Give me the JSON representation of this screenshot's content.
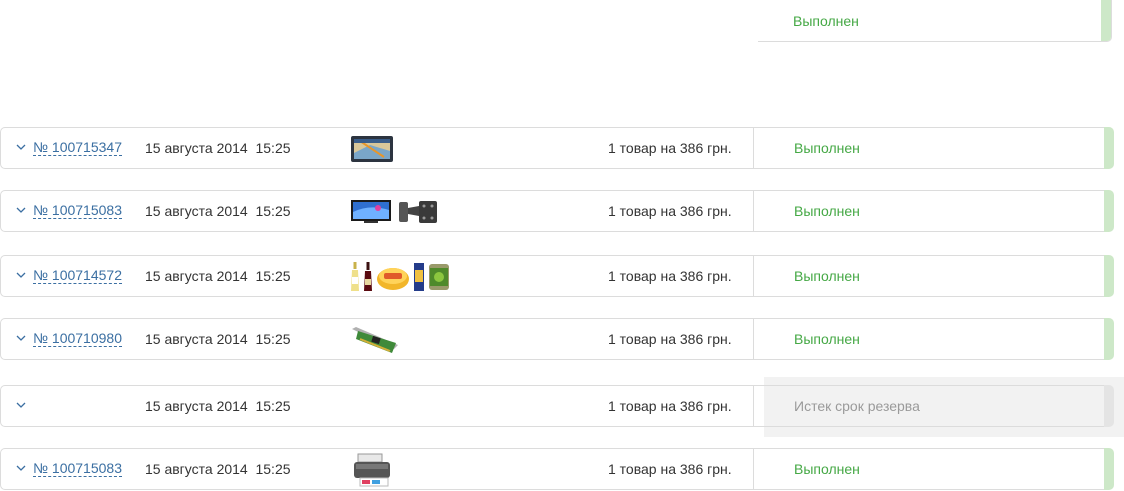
{
  "top_status": {
    "label": "Выполнен",
    "color": "#45a845"
  },
  "orders": [
    {
      "number": "№ 100715347",
      "date": "15 августа 2014  15:25",
      "summary": "1 товар на 386 грн.",
      "status": "Выполнен",
      "status_type": "done",
      "items": [
        "gps-navigator"
      ]
    },
    {
      "number": "№ 100715083",
      "date": "15 августа 2014  15:25",
      "summary": "1 товар на 386 грн.",
      "status": "Выполнен",
      "status_type": "done",
      "items": [
        "tv",
        "tv-wall-mount"
      ]
    },
    {
      "number": "№ 100714572",
      "date": "15 августа 2014  15:25",
      "summary": "1 товар на 386 грн.",
      "status": "Выполнен",
      "status_type": "done",
      "items": [
        "oil-bottle",
        "wine-bottle",
        "cheese",
        "pasta-pack",
        "canned-peas"
      ]
    },
    {
      "number": "№ 100710980",
      "date": "15 августа 2014  15:25",
      "summary": "1 товар на 386 грн.",
      "status": "Выполнен",
      "status_type": "done",
      "items": [
        "network-card"
      ]
    },
    {
      "number": "",
      "date": "15 августа 2014  15:25",
      "summary": "1 товар на 386 грн.",
      "status": "Истек срок резерва",
      "status_type": "expired",
      "items": []
    },
    {
      "number": "№ 100715083",
      "date": "15 августа 2014  15:25",
      "summary": "1 товар на 386 грн.",
      "status": "Выполнен",
      "status_type": "done",
      "items": [
        "printer"
      ]
    }
  ],
  "colors": {
    "link": "#3b6fa2",
    "done": "#45a845",
    "expired": "#9a9a9a",
    "border": "#dcdcdc",
    "done_bar": "#cde8c8"
  }
}
